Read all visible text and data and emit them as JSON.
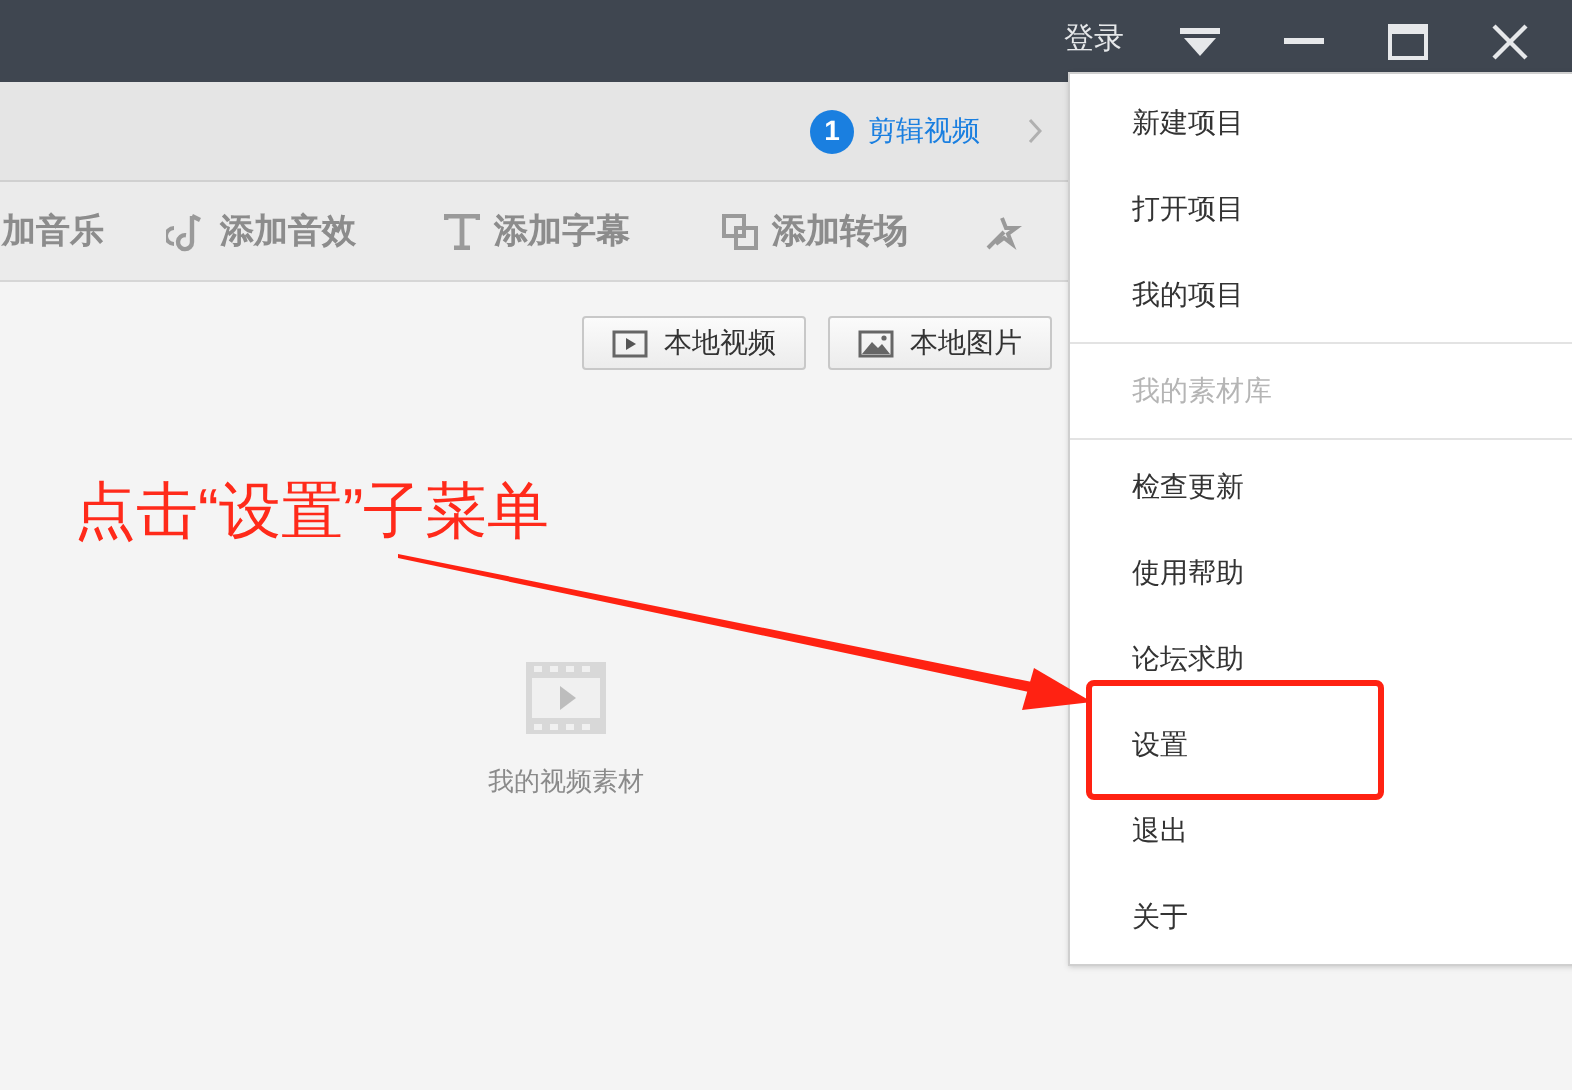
{
  "title_bar": {
    "login": "登录"
  },
  "steps": [
    {
      "number": "1",
      "label": "剪辑视频",
      "selected": true
    }
  ],
  "toolbar": [
    {
      "label": "加音乐"
    },
    {
      "label": "添加音效"
    },
    {
      "label": "添加字幕"
    },
    {
      "label": "添加转场"
    }
  ],
  "import_buttons": [
    {
      "label": "本地视频"
    },
    {
      "label": "本地图片"
    }
  ],
  "empty_state": {
    "text": "我的视频素材"
  },
  "menu": {
    "groups": [
      [
        {
          "label": "新建项目",
          "disabled": false
        },
        {
          "label": "打开项目",
          "disabled": false
        },
        {
          "label": "我的项目",
          "disabled": false
        }
      ],
      [
        {
          "label": "我的素材库",
          "disabled": true
        }
      ],
      [
        {
          "label": "检查更新",
          "disabled": false
        },
        {
          "label": "使用帮助",
          "disabled": false
        },
        {
          "label": "论坛求助",
          "disabled": false
        },
        {
          "label": "设置",
          "disabled": false
        },
        {
          "label": "退出",
          "disabled": false
        },
        {
          "label": "关于",
          "disabled": false
        }
      ]
    ]
  },
  "annotation": {
    "text": "点击“设置”子菜单"
  }
}
